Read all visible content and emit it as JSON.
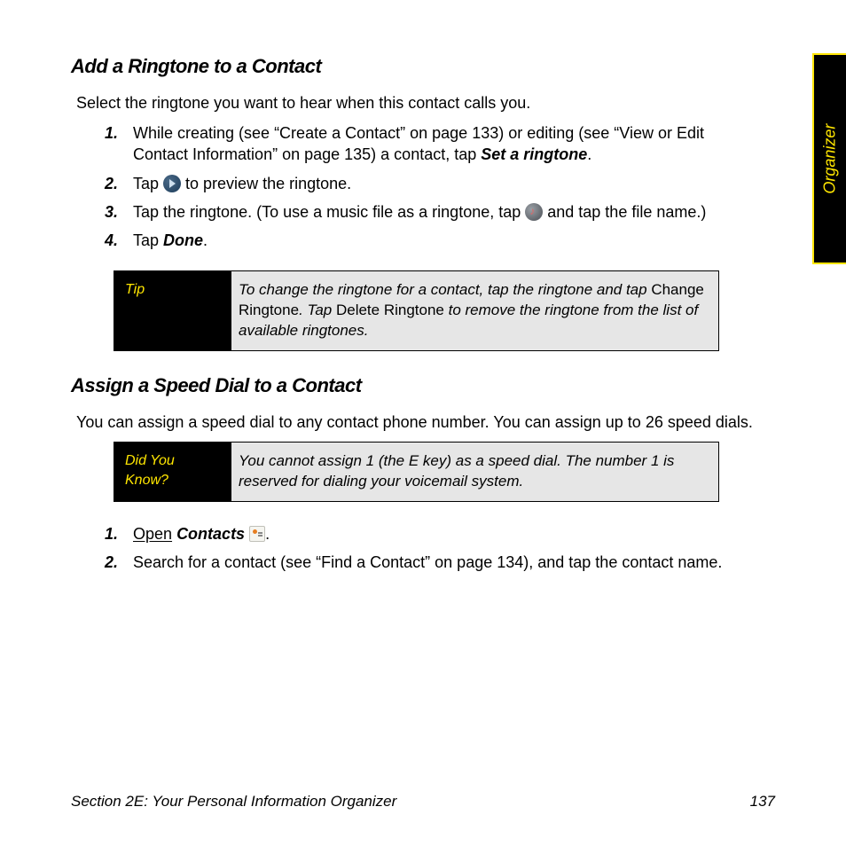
{
  "side_tab": "Organizer",
  "section1": {
    "heading": "Add a Ringtone to a Contact",
    "intro": "Select the ringtone you want to hear when this contact calls you.",
    "list": {
      "n1": "1.",
      "i1a": "While creating (see “Create a Contact” on page 133) or editing (see “View or Edit Contact Information” on page 135) a contact, tap ",
      "i1b": "Set a ringtone",
      "i1c": ".",
      "n2": "2.",
      "i2a": "Tap ",
      "i2b": " to preview the ringtone.",
      "n3": "3.",
      "i3a": "Tap the ringtone. (To use a music file as a ringtone, tap ",
      "i3b": " and tap the file name.)",
      "n4": "4.",
      "i4a": "Tap ",
      "i4b": "Done",
      "i4c": "."
    },
    "tip": {
      "label": "Tip",
      "t1": "To change the ringtone for a contact, tap the ringtone and tap ",
      "b1": "Change Ringtone",
      "t2": ". Tap ",
      "b2": "Delete Ringtone",
      "t3": " to remove the ringtone from the list of available ringtones."
    }
  },
  "section2": {
    "heading": "Assign a Speed Dial to a Contact",
    "intro": "You can assign a speed dial to any contact phone number. You can assign up to 26 speed dials.",
    "dyk": {
      "label": "Did You Know?",
      "text": "You cannot assign 1 (the E key) as a speed dial. The number 1 is reserved for dialing your voicemail system."
    },
    "list": {
      "n1": "1.",
      "i1a": "Open",
      "i1b": "Contacts",
      "i1c": ".",
      "n2": "2.",
      "i2": "Search for a contact (see “Find a Contact” on page 134), and tap the contact name."
    }
  },
  "footer": {
    "left": "Section 2E: Your Personal Information Organizer",
    "right": "137"
  }
}
